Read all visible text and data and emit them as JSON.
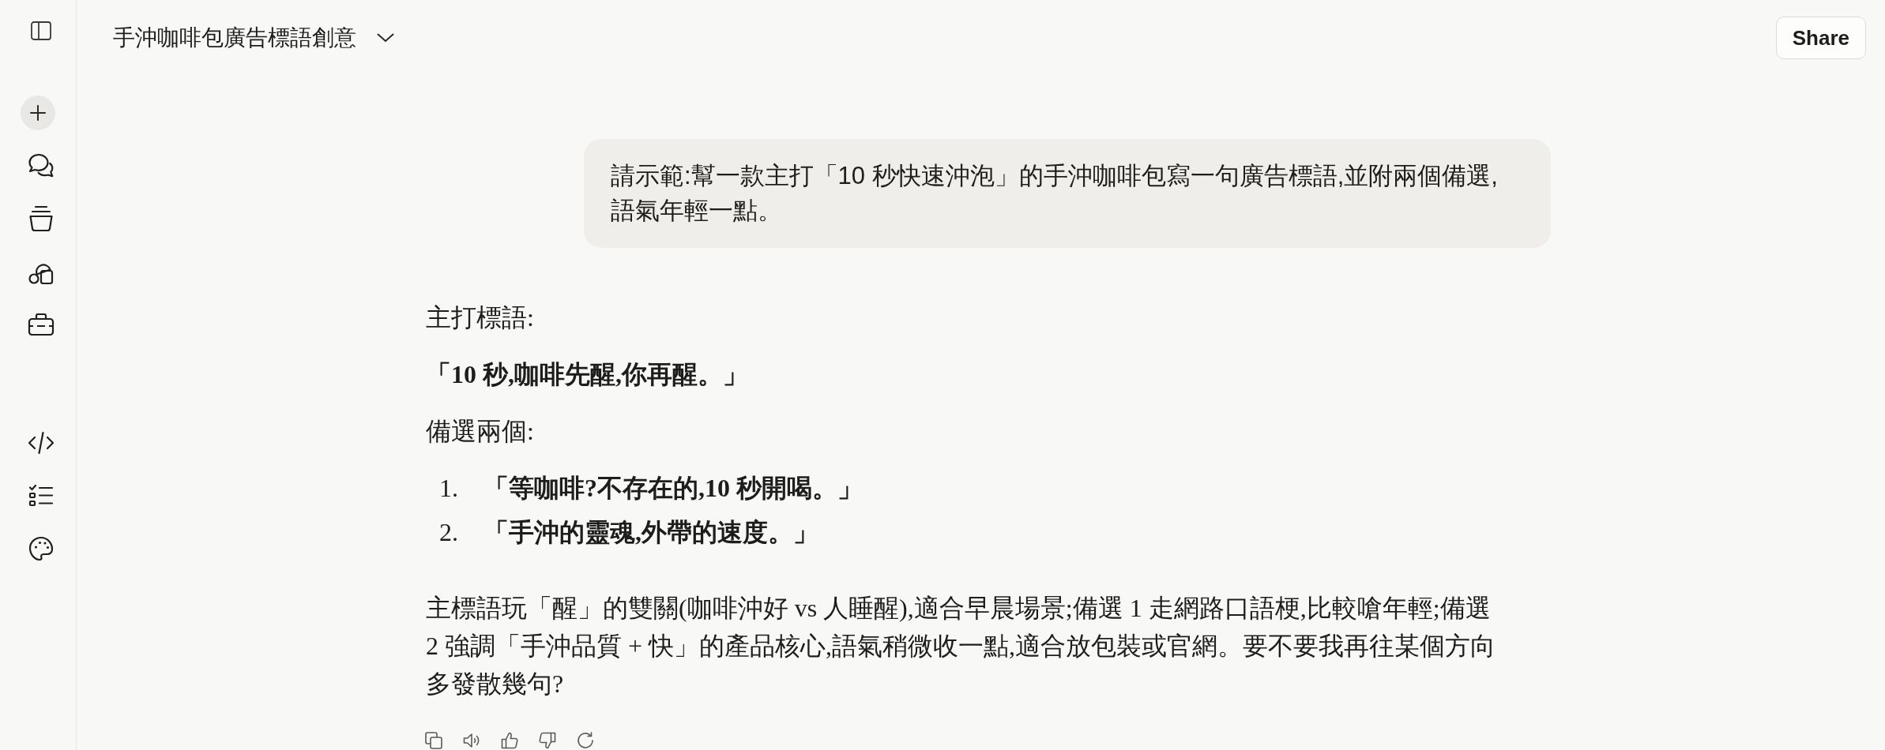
{
  "header": {
    "title": "手沖咖啡包廣告標語創意",
    "share_button": "Share"
  },
  "messages": [
    {
      "kind": "user",
      "text": "請示範:幫一款主打「10 秒快速沖泡」的手沖咖啡包寫一句廣告標語,並附兩個備選,語氣年輕一點。"
    },
    {
      "kind": "assistant",
      "blocks": [
        {
          "kind": "text",
          "text": "主打標語:"
        },
        {
          "kind": "strong",
          "text": "「10 秒,咖啡先醒,你再醒。」"
        },
        {
          "kind": "text",
          "text": "備選兩個:"
        },
        {
          "kind": "list",
          "items": [
            {
              "number": "1.",
              "text": "「等咖啡?不存在的,10 秒開喝。」"
            },
            {
              "number": "2.",
              "text": "「手沖的靈魂,外帶的速度。」"
            }
          ]
        },
        {
          "kind": "text",
          "text": "主標語玩「醒」的雙關(咖啡沖好 vs 人睡醒),適合早晨場景;備選 1 走網路口語梗,比較嗆年輕;備選 2 強調「手沖品質 + 快」的產品核心,語氣稍微收一點,適合放包裝或官網。要不要我再往某個方向多發散幾句?"
        }
      ]
    }
  ]
}
